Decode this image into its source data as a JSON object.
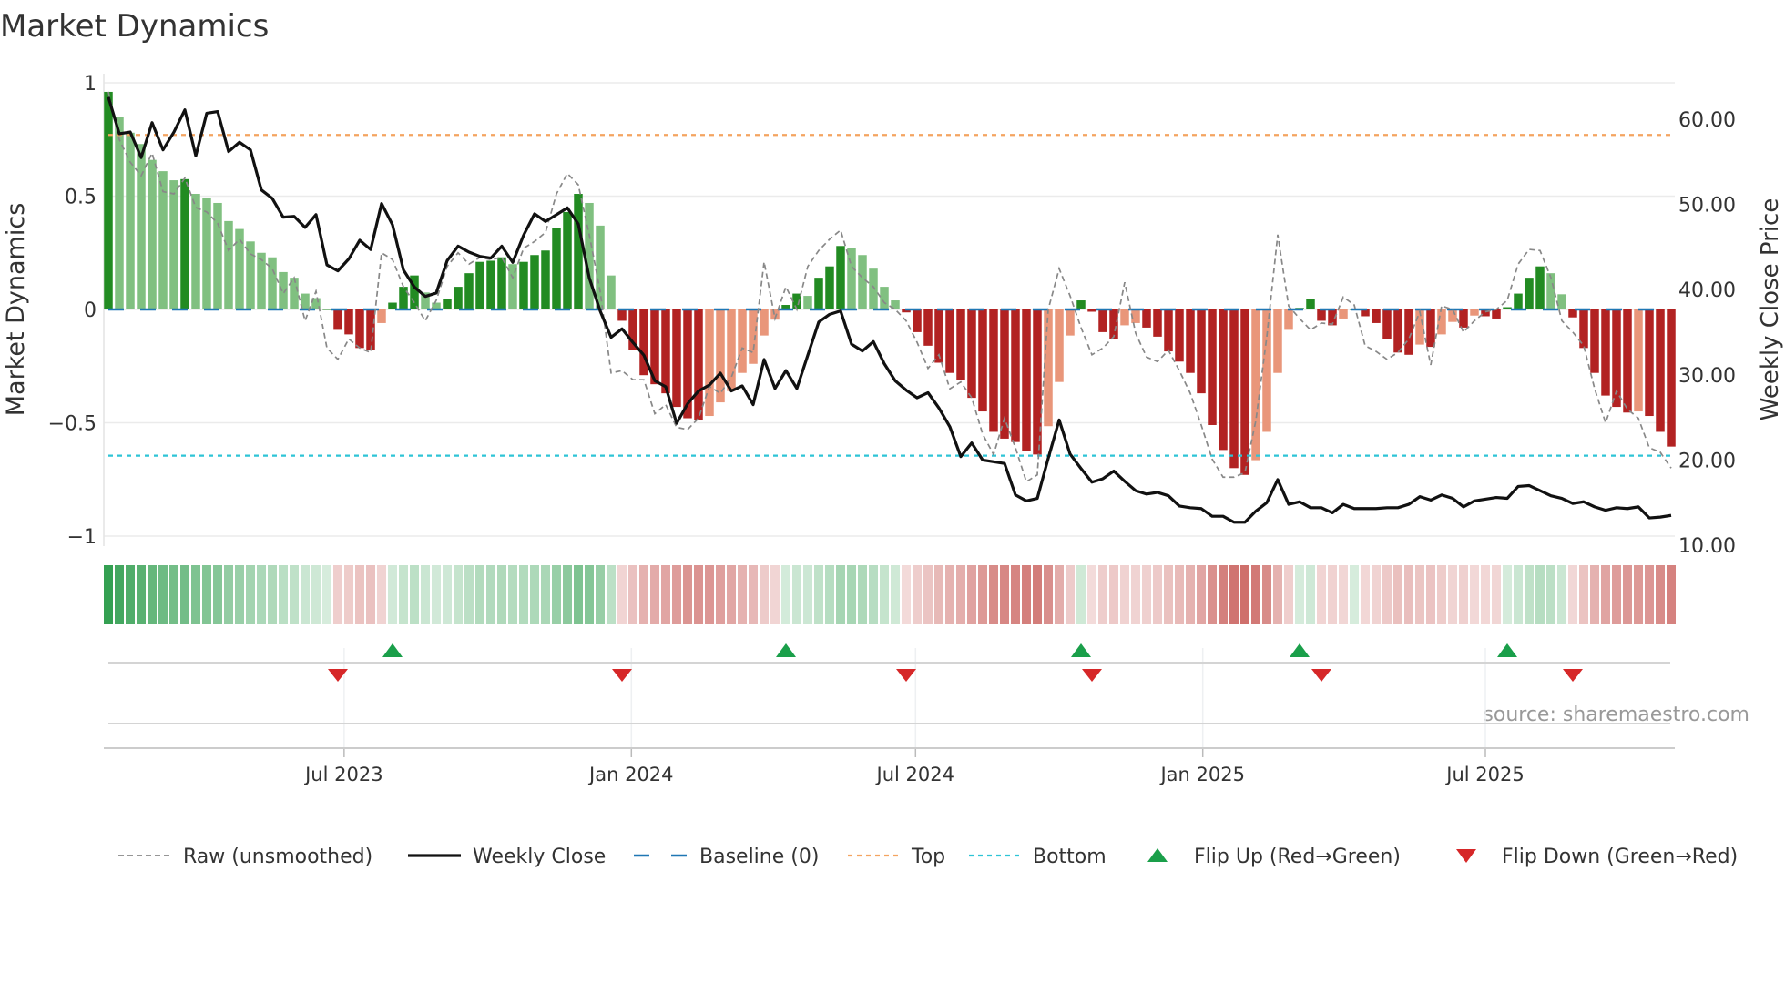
{
  "chart_data": {
    "type": "bar",
    "title": "Market Dynamics",
    "ylabel": "Market Dynamics",
    "y2label": "Weekly Close Price",
    "ylim": [
      -1,
      1
    ],
    "y2lim": [
      10,
      60
    ],
    "x_start": "2023-01-31",
    "frequency": "weekly",
    "grid": true,
    "legend_position": "bottom",
    "source": "source: sharemaestro.com",
    "colors": {
      "pos_strong": "#228b22",
      "pos_weak": "#80c080",
      "neg_strong": "#b22222",
      "neg_weak": "#e9967a",
      "close": "#111111",
      "raw": "#888888",
      "baseline": "#1f77b4",
      "top": "#f4a460",
      "bottom": "#2ec4d6",
      "flip_up": "#1a9f4a",
      "flip_down": "#d62728"
    },
    "top_level": 0.77,
    "bottom_level": -0.645,
    "yticks": [
      {
        "value": 1,
        "label": "1"
      },
      {
        "value": 0.5,
        "label": "0.5"
      },
      {
        "value": 0,
        "label": "0"
      },
      {
        "value": -0.5,
        "label": "−0.5"
      },
      {
        "value": -1,
        "label": "−1"
      }
    ],
    "y2ticks": [
      {
        "value": 60,
        "label": "60.00"
      },
      {
        "value": 50,
        "label": "50.00"
      },
      {
        "value": 40,
        "label": "40.00"
      },
      {
        "value": 30,
        "label": "30.00"
      },
      {
        "value": 20,
        "label": "20.00"
      },
      {
        "value": 10,
        "label": "10.00"
      }
    ],
    "xticks": [
      {
        "date": "2023-07-01",
        "label": "Jul 2023"
      },
      {
        "date": "2024-01-01",
        "label": "Jan 2024"
      },
      {
        "date": "2024-07-01",
        "label": "Jul 2024"
      },
      {
        "date": "2025-01-01",
        "label": "Jan 2025"
      },
      {
        "date": "2025-07-01",
        "label": "Jul 2025"
      }
    ],
    "series": [
      {
        "name": "Market Dynamics (smoothed)",
        "values": [
          0.96,
          0.85,
          0.78,
          0.73,
          0.66,
          0.61,
          0.57,
          0.575,
          0.51,
          0.49,
          0.47,
          0.39,
          0.355,
          0.3,
          0.25,
          0.23,
          0.165,
          0.14,
          0.07,
          0.05,
          0,
          -0.09,
          -0.11,
          -0.17,
          -0.18,
          -0.06,
          0.03,
          0.1,
          0.15,
          0.075,
          0.03,
          0.045,
          0.1,
          0.16,
          0.21,
          0.215,
          0.23,
          0.2,
          0.21,
          0.24,
          0.26,
          0.36,
          0.43,
          0.51,
          0.47,
          0.37,
          0.15,
          -0.05,
          -0.18,
          -0.29,
          -0.33,
          -0.37,
          -0.43,
          -0.48,
          -0.49,
          -0.47,
          -0.41,
          -0.36,
          -0.28,
          -0.24,
          -0.115,
          -0.045,
          0.02,
          0.07,
          0.06,
          0.14,
          0.19,
          0.28,
          0.27,
          0.24,
          0.18,
          0.1,
          0.04,
          -0.013,
          -0.1,
          -0.16,
          -0.235,
          -0.28,
          -0.31,
          -0.39,
          -0.45,
          -0.54,
          -0.57,
          -0.585,
          -0.625,
          -0.64,
          -0.515,
          -0.32,
          -0.115,
          0.04,
          -0.01,
          -0.1,
          -0.13,
          -0.07,
          -0.06,
          -0.08,
          -0.12,
          -0.185,
          -0.23,
          -0.28,
          -0.37,
          -0.51,
          -0.62,
          -0.7,
          -0.73,
          -0.665,
          -0.54,
          -0.28,
          -0.09,
          0.007,
          0.045,
          -0.05,
          -0.07,
          -0.04,
          0,
          -0.03,
          -0.06,
          -0.13,
          -0.19,
          -0.2,
          -0.155,
          -0.165,
          -0.11,
          -0.055,
          -0.08,
          -0.027,
          -0.03,
          -0.04,
          0.01,
          0.07,
          0.14,
          0.19,
          0.16,
          0.067,
          -0.035,
          -0.17,
          -0.28,
          -0.38,
          -0.43,
          -0.455,
          -0.45,
          -0.47,
          -0.54,
          -0.605
        ]
      },
      {
        "name": "Raw (unsmoothed)",
        "values": [
          0.96,
          0.75,
          0.65,
          0.59,
          0.69,
          0.52,
          0.51,
          0.58,
          0.45,
          0.43,
          0.38,
          0.26,
          0.31,
          0.245,
          0.22,
          0.18,
          0.07,
          0.14,
          -0.05,
          0.08,
          -0.17,
          -0.22,
          -0.13,
          -0.17,
          -0.19,
          0.25,
          0.22,
          0.1,
          0.03,
          -0.05,
          0.04,
          0.19,
          0.25,
          0.2,
          0.23,
          0.22,
          0.23,
          0.14,
          0.27,
          0.3,
          0.34,
          0.51,
          0.6,
          0.55,
          0.33,
          0.08,
          -0.28,
          -0.27,
          -0.31,
          -0.31,
          -0.46,
          -0.42,
          -0.52,
          -0.53,
          -0.48,
          -0.34,
          -0.37,
          -0.3,
          -0.17,
          -0.19,
          0.21,
          -0.04,
          0.1,
          0.0,
          0.19,
          0.26,
          0.31,
          0.35,
          0.19,
          0.14,
          0.1,
          0.03,
          0.0,
          -0.05,
          -0.145,
          -0.26,
          -0.2,
          -0.35,
          -0.32,
          -0.39,
          -0.55,
          -0.64,
          -0.48,
          -0.61,
          -0.76,
          -0.73,
          0.0,
          0.18,
          0.06,
          -0.08,
          -0.2,
          -0.17,
          -0.12,
          0.12,
          -0.105,
          -0.21,
          -0.23,
          -0.18,
          -0.27,
          -0.37,
          -0.51,
          -0.66,
          -0.74,
          -0.74,
          -0.72,
          -0.49,
          -0.12,
          0.33,
          0.015,
          -0.04,
          -0.09,
          -0.06,
          -0.065,
          0.055,
          0.02,
          -0.16,
          -0.185,
          -0.22,
          -0.19,
          -0.13,
          -0.01,
          -0.245,
          0.016,
          0.0,
          -0.1,
          -0.05,
          -0.01,
          0.0,
          0.04,
          0.2,
          0.265,
          0.26,
          0.14,
          -0.05,
          -0.1,
          -0.16,
          -0.35,
          -0.5,
          -0.36,
          -0.44,
          -0.48,
          -0.61,
          -0.63,
          -0.7
        ]
      },
      {
        "name": "Weekly Close",
        "axis": "right",
        "values": [
          62.6,
          58.3,
          58.5,
          55.5,
          59.6,
          56.4,
          58.5,
          61.1,
          55.7,
          60.7,
          60.9,
          56.2,
          57.3,
          56.4,
          51.7,
          50.7,
          48.5,
          48.6,
          47.3,
          48.8,
          42.9,
          42.2,
          43.6,
          45.8,
          44.7,
          50.1,
          47.6,
          42.3,
          40.3,
          39.2,
          39.6,
          43.4,
          45.1,
          44.4,
          43.9,
          43.7,
          45.1,
          43.2,
          46.4,
          48.9,
          48.0,
          48.8,
          49.6,
          47.7,
          41.4,
          37.5,
          34.4,
          35.4,
          33.8,
          32.3,
          29.3,
          28.6,
          24.3,
          26.6,
          28.1,
          28.8,
          30.2,
          28.1,
          28.7,
          26.5,
          31.8,
          28.4,
          30.5,
          28.4,
          32.3,
          36.2,
          37.1,
          37.5,
          33.6,
          32.8,
          33.9,
          31.3,
          29.3,
          28.2,
          27.3,
          27.9,
          26.1,
          23.9,
          20.4,
          22.0,
          20.0,
          19.8,
          19.6,
          15.9,
          15.2,
          15.5,
          20.2,
          24.7,
          20.7,
          19.0,
          17.4,
          17.8,
          18.7,
          17.5,
          16.4,
          16.0,
          16.2,
          15.8,
          14.6,
          14.4,
          14.3,
          13.4,
          13.4,
          12.7,
          12.7,
          14.0,
          15.0,
          17.7,
          14.8,
          15.1,
          14.4,
          14.4,
          13.8,
          14.8,
          14.3,
          14.3,
          14.3,
          14.4,
          14.4,
          14.8,
          15.7,
          15.3,
          15.9,
          15.5,
          14.5,
          15.2,
          15.4,
          15.6,
          15.5,
          16.9,
          17.0,
          16.4,
          15.8,
          15.5,
          14.9,
          15.1,
          14.5,
          14.1,
          14.4,
          14.3,
          14.5,
          13.2,
          13.3,
          13.5
        ]
      }
    ],
    "legend": [
      {
        "key": "raw",
        "label": "Raw (unsmoothed)"
      },
      {
        "key": "close",
        "label": "Weekly Close"
      },
      {
        "key": "baseline",
        "label": "Baseline (0)"
      },
      {
        "key": "top",
        "label": "Top"
      },
      {
        "key": "bottom",
        "label": "Bottom"
      },
      {
        "key": "flip_up",
        "label": "Flip Up (Red→Green)"
      },
      {
        "key": "flip_down",
        "label": "Flip Down (Green→Red)"
      }
    ]
  }
}
